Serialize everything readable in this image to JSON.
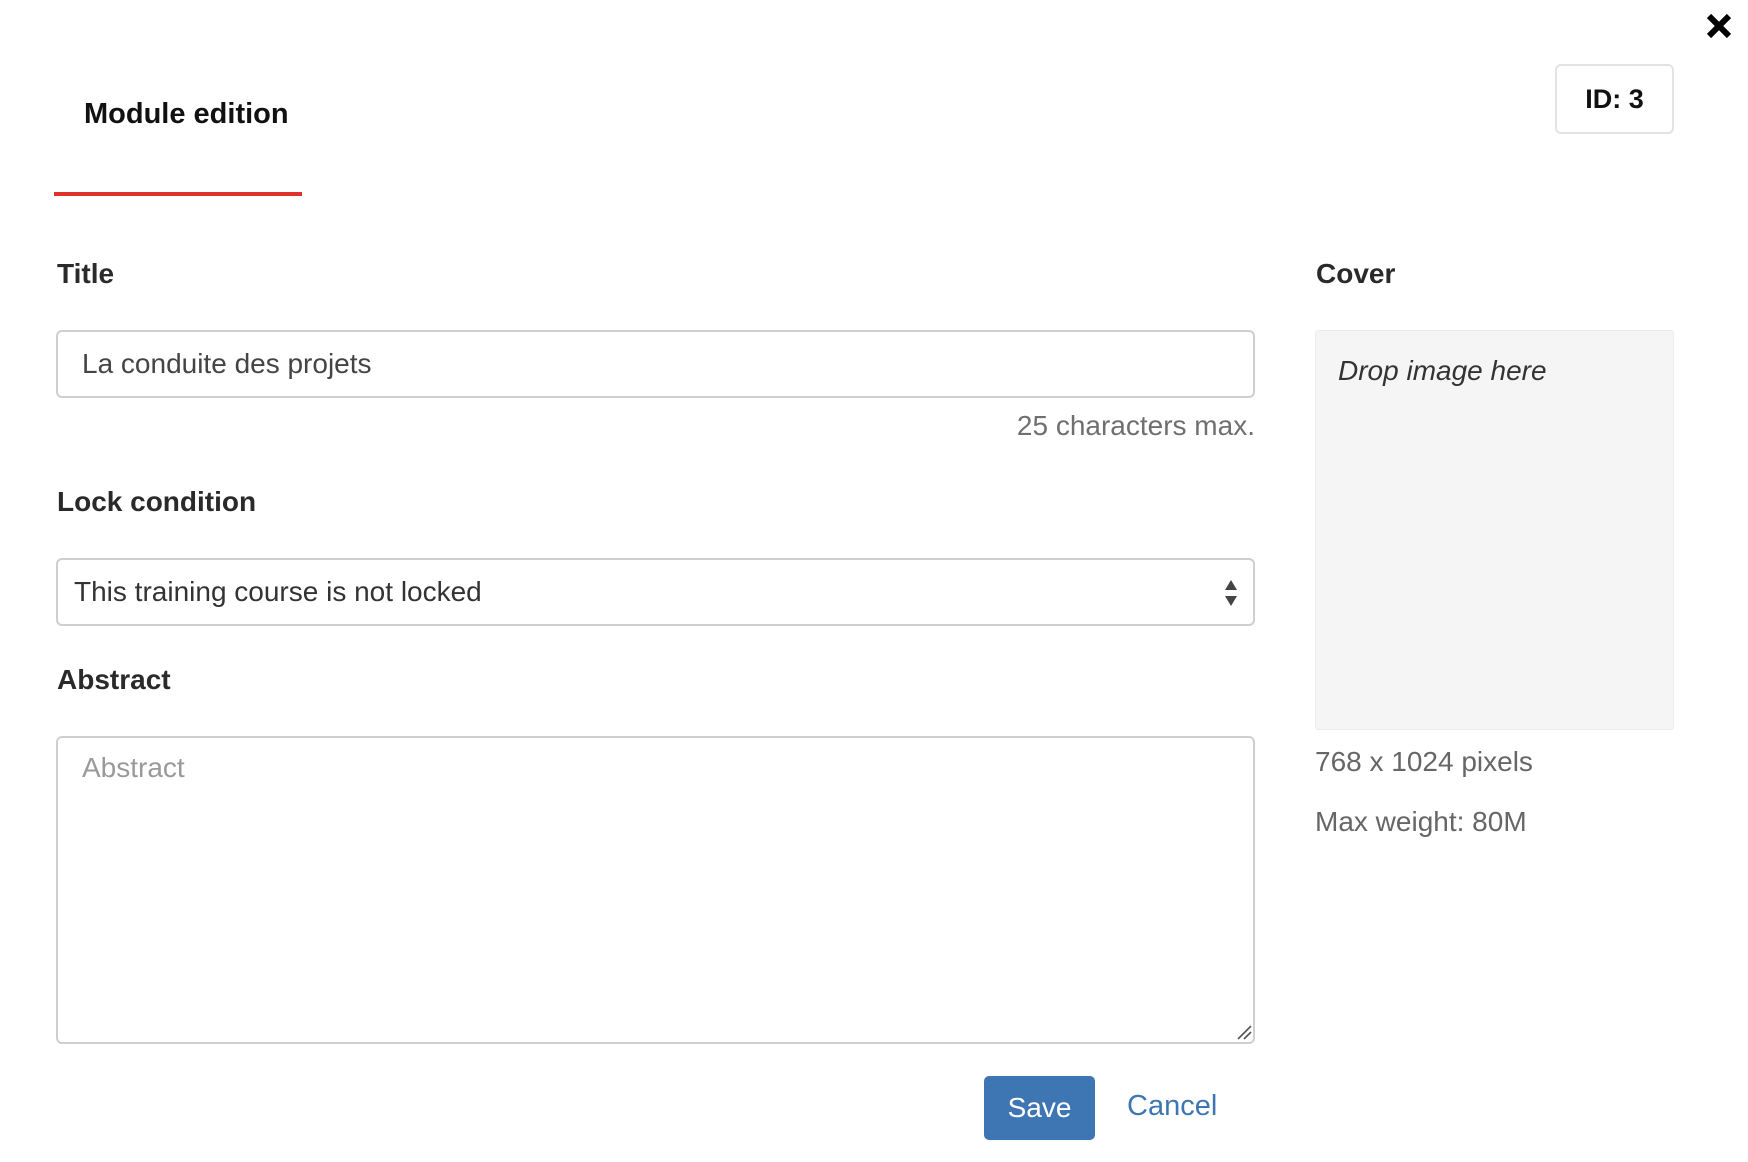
{
  "header": {
    "title": "Module edition",
    "id_badge": "ID: 3",
    "accent_color": "#e0322b"
  },
  "close": {
    "icon": "close-icon"
  },
  "form": {
    "title": {
      "label": "Title",
      "value": "La conduite des projets",
      "help": "25 characters max."
    },
    "lock_condition": {
      "label": "Lock condition",
      "selected": "This training course is not locked",
      "icon": "select-arrows-icon"
    },
    "abstract": {
      "label": "Abstract",
      "value": "",
      "placeholder": "Abstract"
    }
  },
  "cover": {
    "label": "Cover",
    "dropzone_text": "Drop image here",
    "dimensions": "768 x 1024 pixels",
    "max_weight": "Max weight: 80M"
  },
  "actions": {
    "save_label": "Save",
    "cancel_label": "Cancel",
    "primary_color": "#3d76b2"
  }
}
